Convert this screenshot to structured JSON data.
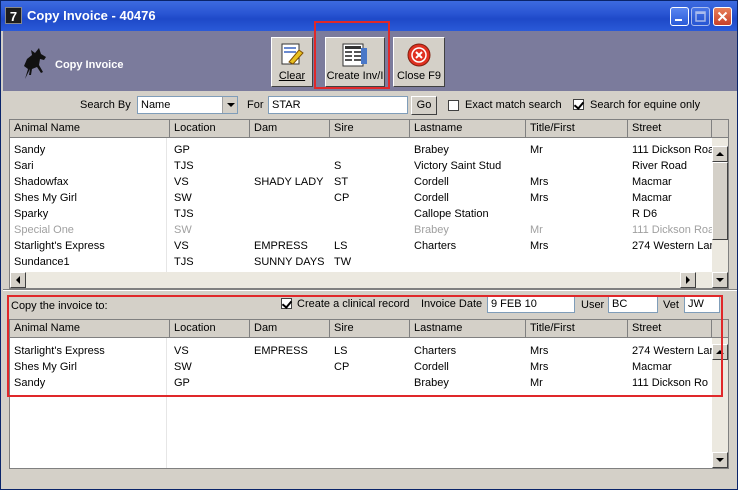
{
  "window": {
    "title": "Copy Invoice - 40476",
    "app_icon": "7"
  },
  "header": {
    "title": "Copy Invoice",
    "buttons": {
      "clear": "Clear",
      "create": "Create Inv/I",
      "close": "Close F9"
    }
  },
  "search": {
    "search_by_label": "Search By",
    "search_by_value": "Name",
    "for_label": "For",
    "for_value": "STAR",
    "go_label": "Go",
    "exact_match_label": "Exact match search",
    "exact_match_checked": false,
    "equine_only_label": "Search for equine only",
    "equine_only_checked": true
  },
  "columns": [
    "Animal Name",
    "Location",
    "Dam",
    "Sire",
    "Lastname",
    "Title/First",
    "Street"
  ],
  "results": [
    {
      "name": "Sandy",
      "location": "GP",
      "dam": "",
      "sire": "",
      "lastname": "Brabey",
      "title": "Mr",
      "street": "111 Dickson Roa"
    },
    {
      "name": "Sari",
      "location": "TJS",
      "dam": "",
      "sire": "S",
      "lastname": "Victory Saint Stud",
      "title": "",
      "street": "River Road"
    },
    {
      "name": "Shadowfax",
      "location": "VS",
      "dam": "SHADY LADY",
      "sire": "ST",
      "lastname": "Cordell",
      "title": "Mrs",
      "street": "Macmar"
    },
    {
      "name": "Shes My Girl",
      "location": "SW",
      "dam": "",
      "sire": "CP",
      "lastname": "Cordell",
      "title": "Mrs",
      "street": "Macmar"
    },
    {
      "name": "Sparky",
      "location": "TJS",
      "dam": "",
      "sire": "",
      "lastname": "Callope Station",
      "title": "",
      "street": "R D6"
    },
    {
      "name": "Special One",
      "location": "SW",
      "dam": "",
      "sire": "",
      "lastname": "Brabey",
      "title": "Mr",
      "street": "111 Dickson Roa"
    },
    {
      "name": "Starlight's Express",
      "location": "VS",
      "dam": "EMPRESS",
      "sire": "LS",
      "lastname": "Charters",
      "title": "Mrs",
      "street": "274 Western Lar"
    },
    {
      "name": "Sundance1",
      "location": "TJS",
      "dam": "SUNNY DAYS",
      "sire": "TW",
      "lastname": "",
      "title": "",
      "street": ""
    }
  ],
  "copy_section": {
    "label": "Copy the invoice to:",
    "clinical_label": "Create a clinical record",
    "clinical_checked": true,
    "invoice_date_label": "Invoice Date",
    "invoice_date_value": "9 FEB 10",
    "user_label": "User",
    "user_value": "BC",
    "vet_label": "Vet",
    "vet_value": "JW"
  },
  "targets": [
    {
      "name": "Starlight's Express",
      "location": "VS",
      "dam": "EMPRESS",
      "sire": "LS",
      "lastname": "Charters",
      "title": "Mrs",
      "street": "274 Western Lar"
    },
    {
      "name": "Shes My Girl",
      "location": "SW",
      "dam": "",
      "sire": "CP",
      "lastname": "Cordell",
      "title": "Mrs",
      "street": "Macmar"
    },
    {
      "name": "Sandy",
      "location": "GP",
      "dam": "",
      "sire": "",
      "lastname": "Brabey",
      "title": "Mr",
      "street": "111 Dickson Ro"
    }
  ],
  "icons": {
    "app": "app-icon",
    "logo": "horse-logo-icon",
    "clear": "clear-document-icon",
    "create": "create-invoice-icon",
    "close": "close-icon"
  },
  "colors": {
    "titlebar": "#2a56d4",
    "header": "#7b7b9c",
    "highlight": "#e0282a"
  }
}
